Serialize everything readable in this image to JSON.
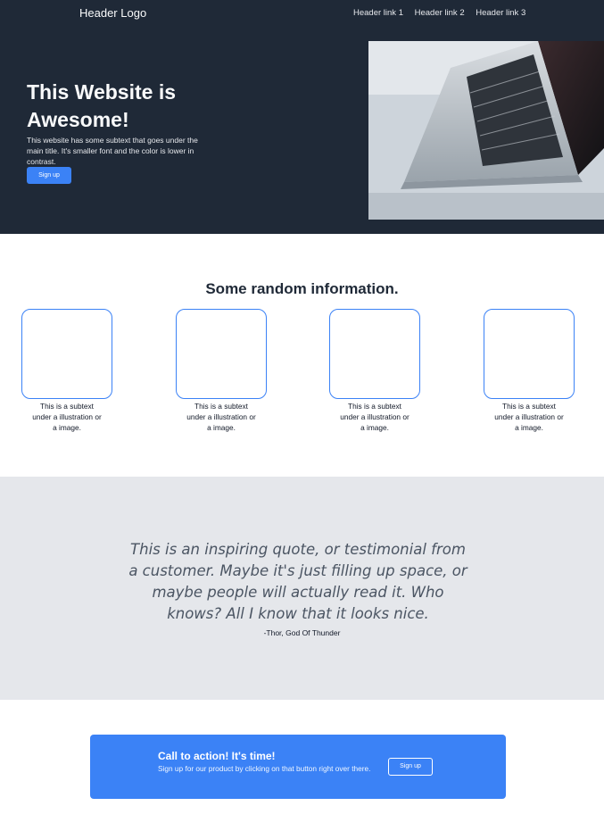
{
  "header": {
    "logo": "Header Logo",
    "links": [
      "Header link 1",
      "Header link 2",
      "Header link 3"
    ]
  },
  "hero": {
    "title": "This Website is Awesome!",
    "subtitle": "This website has some subtext that goes under the main title. It's smaller font and the color is lower in contrast.",
    "button": "Sign up"
  },
  "info": {
    "title": "Some random information.",
    "cards": [
      {
        "text": "This is a subtext under a illustration or a image."
      },
      {
        "text": "This is a subtext under a illustration or a image."
      },
      {
        "text": "This is a subtext under a illustration or a image."
      },
      {
        "text": "This is a subtext under a illustration or a image."
      }
    ]
  },
  "quote": {
    "text": "This is an inspiring quote, or testimonial from a customer. Maybe it's just filling up space, or maybe people will actually read it. Who knows? All I know that it looks nice.",
    "author": "-Thor, God Of Thunder"
  },
  "cta": {
    "title": "Call to action! It's time!",
    "text": "Sign up for our product by clicking on that button right over there.",
    "button": "Sign up"
  },
  "colors": {
    "dark": "#1f2937",
    "accent": "#3b82f6",
    "quote_bg": "#e5e7eb"
  }
}
